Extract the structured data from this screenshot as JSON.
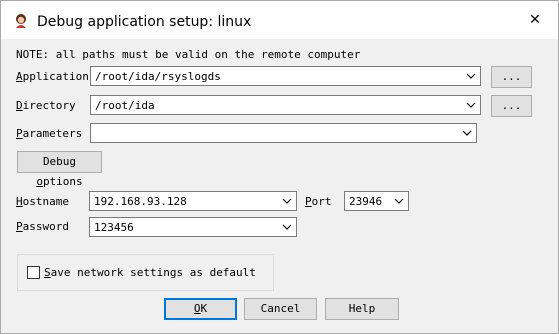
{
  "window": {
    "title": "Debug application setup: linux",
    "close_glyph": "✕"
  },
  "note": "NOTE: all paths must be valid on the remote computer",
  "application": {
    "label_accel": "A",
    "label_rest": "pplication",
    "value": "/root/ida/rsyslogds",
    "browse_label": "..."
  },
  "directory": {
    "label_accel": "D",
    "label_rest": "irectory",
    "value": "/root/ida",
    "browse_label": "..."
  },
  "parameters": {
    "label_accel": "P",
    "label_rest": "arameters",
    "value": ""
  },
  "debug_options": {
    "label_pre": "Debug ",
    "label_accel": "o",
    "label_rest": "ptions"
  },
  "hostname": {
    "label_accel": "H",
    "label_rest": "ostname",
    "value": "192.168.93.128"
  },
  "port": {
    "label_accel": "P",
    "label_rest": "ort",
    "value": "23946"
  },
  "password": {
    "label_accel": "P",
    "label_rest": "assword",
    "value": "123456"
  },
  "save_settings": {
    "label_accel": "S",
    "label_rest": "ave network settings as default",
    "checked": false
  },
  "buttons": {
    "ok_accel": "O",
    "ok_rest": "K",
    "cancel": "Cancel",
    "help": "Help"
  }
}
